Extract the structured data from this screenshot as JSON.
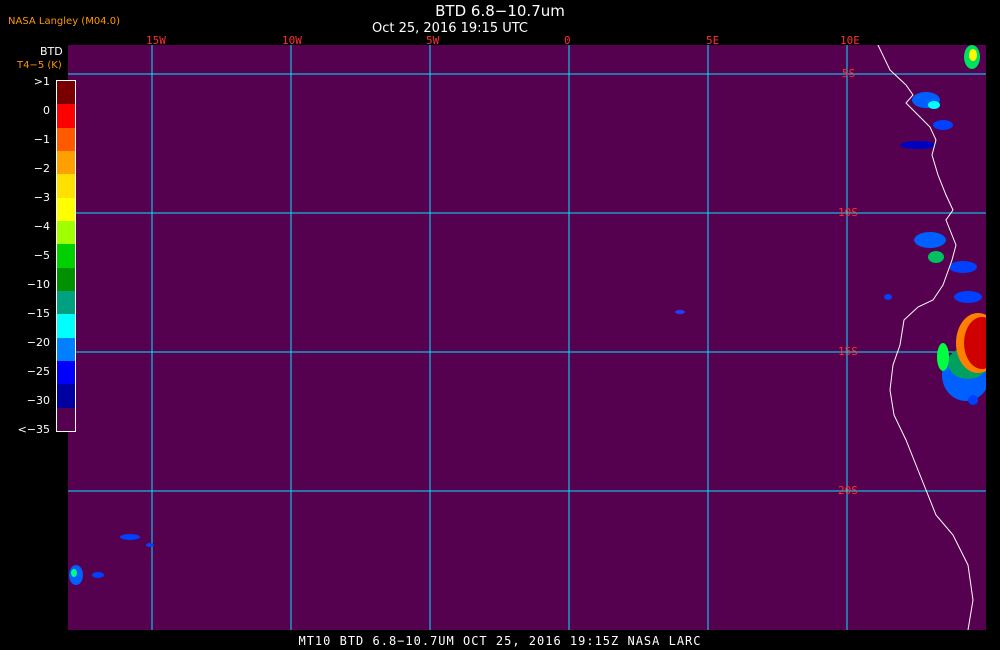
{
  "header": {
    "provider": "NASA Langley (M04.0)",
    "title": "BTD 6.8−10.7um",
    "subtitle": "Oct 25, 2016 19:15 UTC"
  },
  "legend": {
    "title": "BTD",
    "unit": "T4−5 (K)",
    "ticks": [
      ">1",
      "0",
      "−1",
      "−2",
      "−3",
      "−4",
      "−5",
      "−10",
      "−15",
      "−20",
      "−25",
      "−30",
      "<−35"
    ],
    "colors": [
      "#7a0000",
      "#ff0000",
      "#ff5a00",
      "#ffa000",
      "#ffe000",
      "#ffff00",
      "#a0ff00",
      "#00d000",
      "#009000",
      "#00a080",
      "#00ffff",
      "#0080ff",
      "#0000ff",
      "#0000a0",
      "#560050"
    ]
  },
  "grid": {
    "lon_labels": [
      "15W",
      "10W",
      "5W",
      "0",
      "5E",
      "10E"
    ],
    "lat_labels": [
      "5S",
      "10S",
      "15S",
      "20S"
    ]
  },
  "footer": {
    "text": "MT10   BTD 6.8−10.7UM   OCT 25, 2016 19:15Z   NASA LARC"
  },
  "colors": {
    "background_field": "#560050",
    "grid": "#00e5ff",
    "coastline": "#ffffff",
    "grid_label": "#ff3030"
  }
}
